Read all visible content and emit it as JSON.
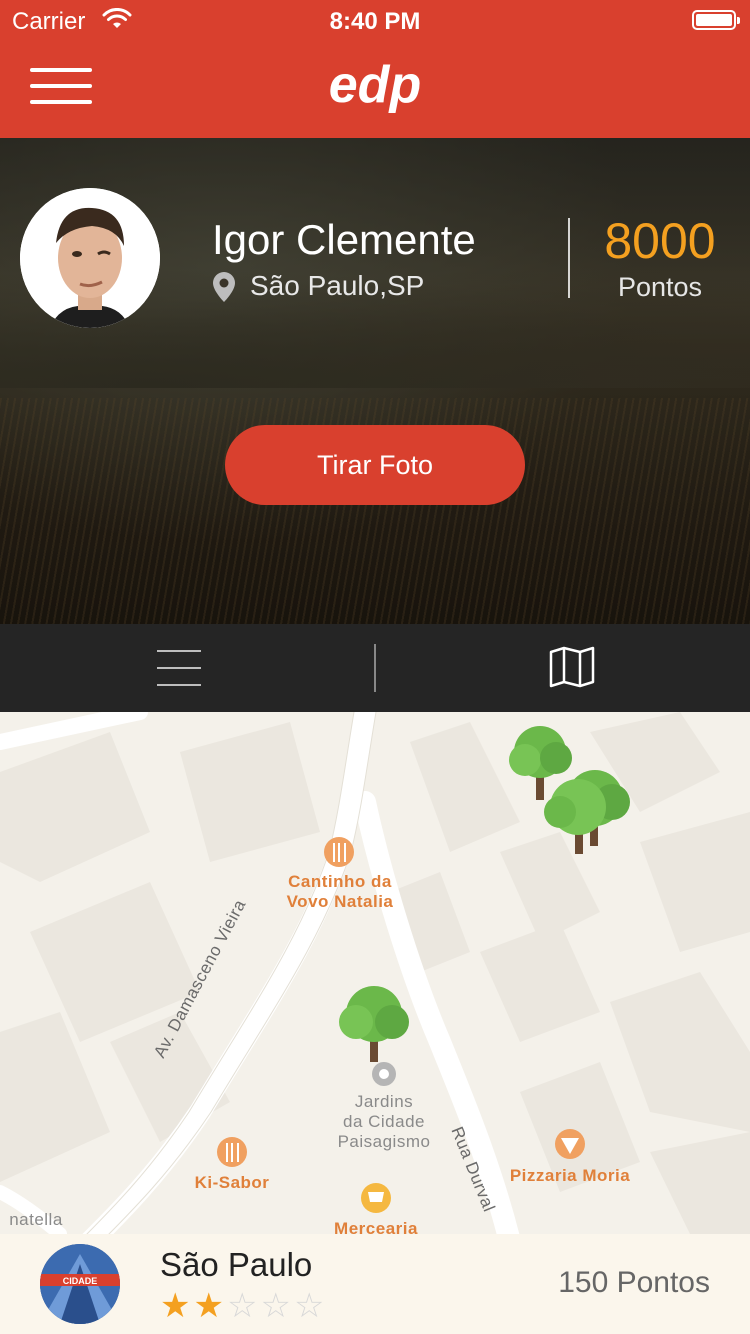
{
  "status_bar": {
    "carrier": "Carrier",
    "time": "8:40 PM"
  },
  "nav": {
    "logo_text": "edp"
  },
  "profile": {
    "name": "Igor Clemente",
    "location": "São Paulo,SP",
    "points_value": "8000",
    "points_label": "Pontos",
    "photo_button": "Tirar Foto"
  },
  "map": {
    "pois": [
      {
        "label_line1": "Cantinho da",
        "label_line2": "Vovo Natalia",
        "type": "restaurant"
      },
      {
        "label_line1": "Jardins",
        "label_line2": "da Cidade",
        "label_line3": "Paisagismo",
        "type": "place"
      },
      {
        "label_line1": "Ki-Sabor",
        "type": "restaurant"
      },
      {
        "label_line1": "Pizzaria Moria",
        "type": "pizza"
      },
      {
        "label_line1": "Mercearia",
        "type": "grocery"
      },
      {
        "label_line1": "natella",
        "type": "partial"
      }
    ],
    "streets": [
      "Av. Damasceno Vieira",
      "Rua Durval"
    ]
  },
  "card": {
    "city": "São Paulo",
    "rating": 2,
    "rating_max": 5,
    "points": "150 Pontos",
    "thumb_text": "CIDADE"
  },
  "colors": {
    "brand_red": "#d9402e",
    "accent_orange": "#f4a020"
  }
}
